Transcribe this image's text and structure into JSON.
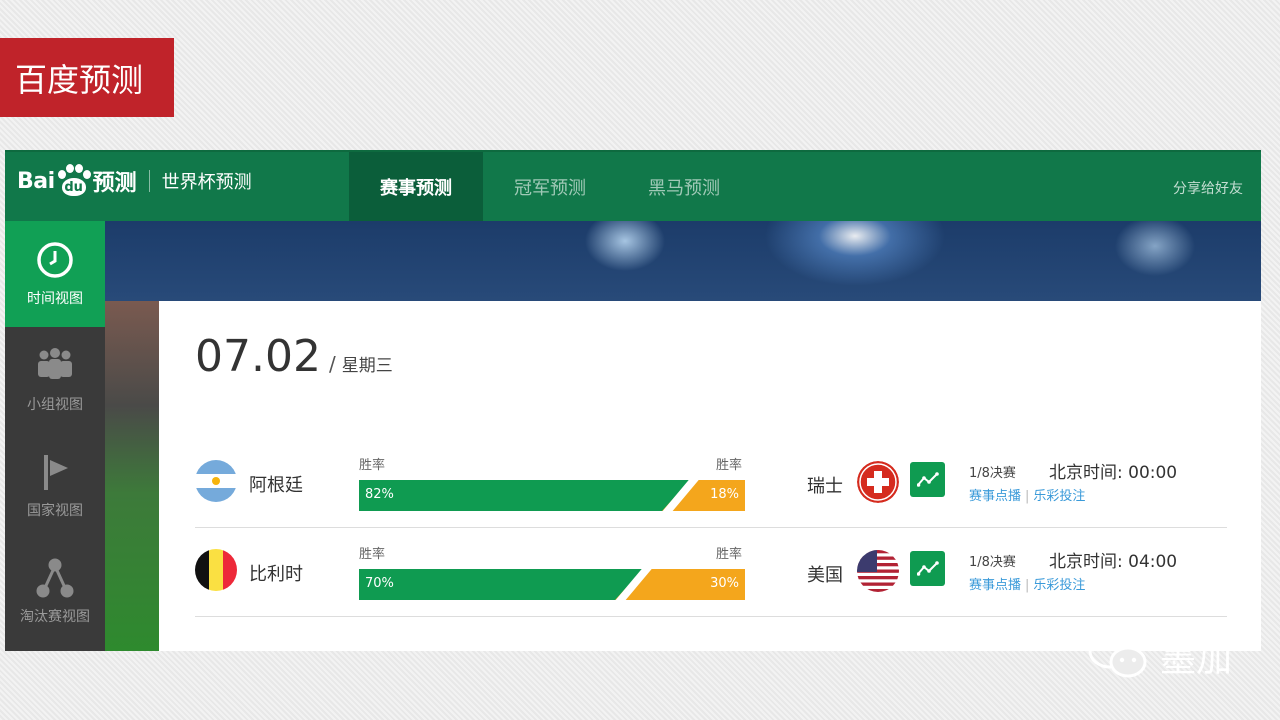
{
  "slide": {
    "title": "百度预测"
  },
  "header": {
    "logo_bai": "Bai",
    "logo_du": "du",
    "logo_product": "预测",
    "subtitle": "世界杯预测",
    "tabs": [
      {
        "label": "赛事预测",
        "active": true
      },
      {
        "label": "冠军预测",
        "active": false
      },
      {
        "label": "黑马预测",
        "active": false
      }
    ],
    "share": "分享给好友"
  },
  "sidebar": {
    "items": [
      {
        "label": "时间视图",
        "icon": "clock-icon",
        "active": true
      },
      {
        "label": "小组视图",
        "icon": "group-icon",
        "active": false
      },
      {
        "label": "国家视图",
        "icon": "flag-icon",
        "active": false
      },
      {
        "label": "淘汰赛视图",
        "icon": "bracket-icon",
        "active": false
      }
    ]
  },
  "date": {
    "day": "07.02",
    "sep": "/",
    "weekday": "星期三"
  },
  "matches": [
    {
      "home": "阿根廷",
      "home_flag": "argentina-flag-icon",
      "home_label": "胜率",
      "away_label": "胜率",
      "home_pct": "82%",
      "away_pct": "18%",
      "home_share": 0.82,
      "away": "瑞士",
      "away_flag": "switzerland-flag-icon",
      "stage": "1/8决赛",
      "time": "北京时间: 00:00",
      "link1": "赛事点播",
      "link_sep": "|",
      "link2": "乐彩投注"
    },
    {
      "home": "比利时",
      "home_flag": "belgium-flag-icon",
      "home_label": "胜率",
      "away_label": "胜率",
      "home_pct": "70%",
      "away_pct": "30%",
      "home_share": 0.7,
      "away": "美国",
      "away_flag": "usa-flag-icon",
      "stage": "1/8决赛",
      "time": "北京时间: 04:00",
      "link1": "赛事点播",
      "link_sep": "|",
      "link2": "乐彩投注"
    }
  ],
  "watermark": {
    "text": "墨加"
  },
  "colors": {
    "brand_green": "#11784a",
    "win_green": "#0f9b51",
    "loss_orange": "#f4a61c",
    "slide_red": "#c0232a",
    "link_blue": "#3a9ad9"
  }
}
